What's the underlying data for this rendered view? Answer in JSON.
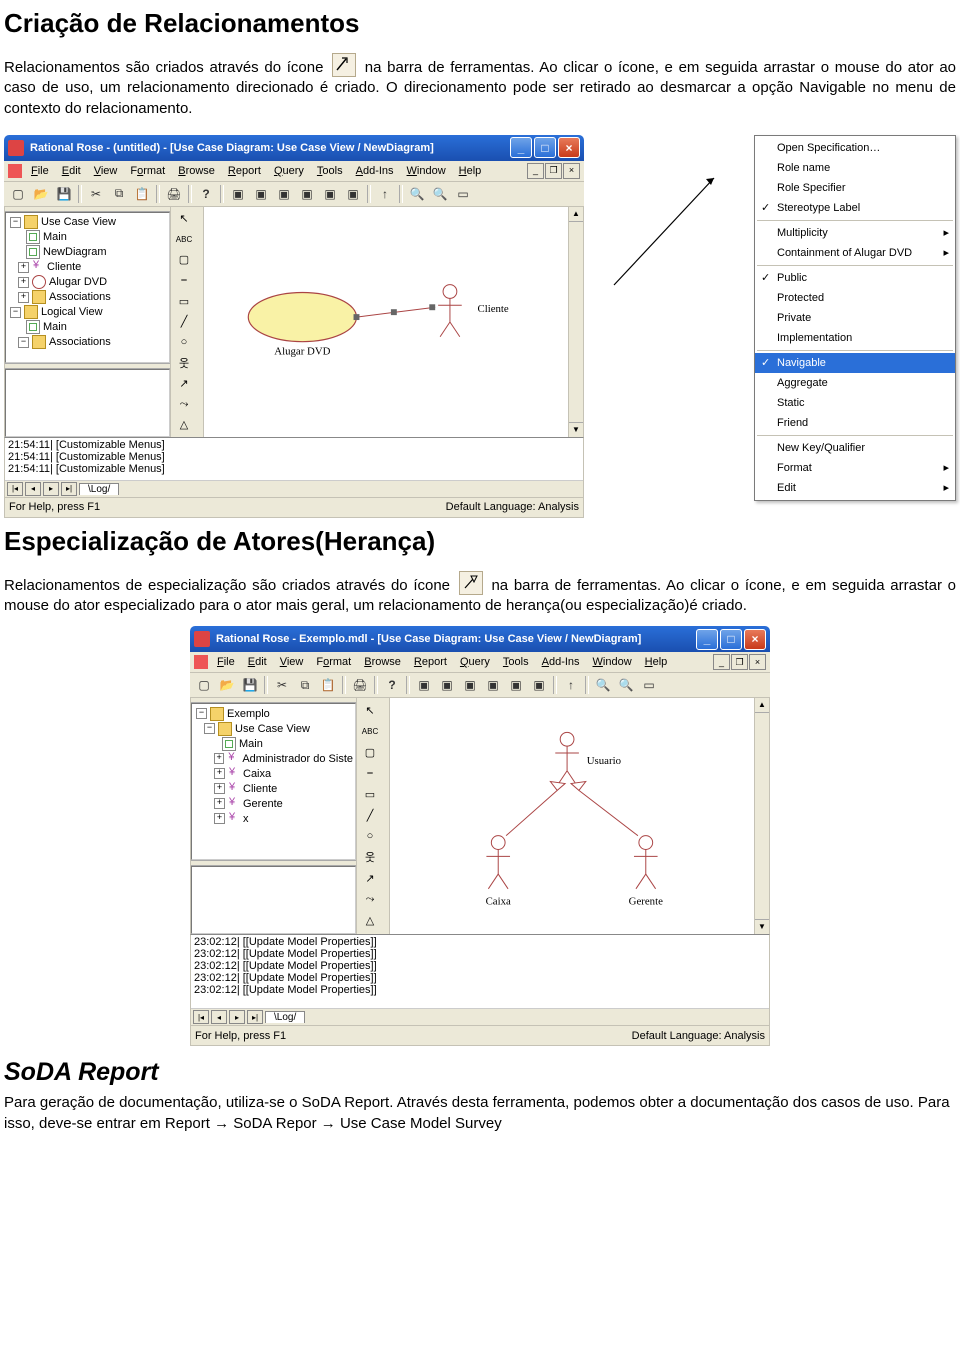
{
  "section1": {
    "title": "Criação de Relacionamentos",
    "p1a": "Relacionamentos são criados através do ícone ",
    "p1b": " na barra de ferramentas. Ao clicar o ícone, e em seguida arrastar o mouse do ator ao caso de uso, um relacionamento direcionado é criado. O direcionamento pode ser retirado ao desmarcar a opção Navigable no menu de contexto do relacionamento."
  },
  "app1": {
    "title": "Rational Rose - (untitled) - [Use Case Diagram: Use Case View / NewDiagram]",
    "menus": [
      "File",
      "Edit",
      "View",
      "Format",
      "Browse",
      "Report",
      "Query",
      "Tools",
      "Add-Ins",
      "Window",
      "Help"
    ],
    "tree": {
      "root": "Use Case View",
      "items": [
        {
          "icon": "diagram",
          "label": "Main",
          "indent": 1
        },
        {
          "icon": "diagram",
          "label": "NewDiagram",
          "indent": 1
        },
        {
          "icon": "actor",
          "label": "Cliente",
          "indent": 1,
          "exp": "+"
        },
        {
          "icon": "usecase",
          "label": "Alugar DVD",
          "indent": 1,
          "exp": "+"
        },
        {
          "icon": "folder",
          "label": "Associations",
          "indent": 1,
          "exp": "+"
        }
      ],
      "root2": "Logical View",
      "items2": [
        {
          "icon": "diagram",
          "label": "Main",
          "indent": 1
        },
        {
          "icon": "folder",
          "label": "Associations",
          "indent": 1,
          "exp": "-"
        }
      ]
    },
    "usecase_label": "Alugar DVD",
    "actor_label": "Cliente",
    "log": [
      "21:54:11|  [Customizable Menus]",
      "21:54:11|  [Customizable Menus]",
      "21:54:11|  [Customizable Menus]"
    ],
    "log_tab": "Log",
    "status_left": "For Help, press F1",
    "status_right": "Default Language: Analysis"
  },
  "ctxmenu": {
    "items": [
      {
        "label": "Open Specification…"
      },
      {
        "label": "Role name"
      },
      {
        "label": "Role Specifier"
      },
      {
        "label": "Stereotype Label",
        "checked": true
      },
      {
        "sep": true
      },
      {
        "label": "Multiplicity",
        "submenu": true
      },
      {
        "label": "Containment of Alugar DVD",
        "submenu": true
      },
      {
        "sep": true
      },
      {
        "label": "Public",
        "checked": true
      },
      {
        "label": "Protected"
      },
      {
        "label": "Private"
      },
      {
        "label": "Implementation"
      },
      {
        "sep": true
      },
      {
        "label": "Navigable",
        "checked": true,
        "sel": true
      },
      {
        "label": "Aggregate"
      },
      {
        "label": "Static"
      },
      {
        "label": "Friend"
      },
      {
        "sep": true
      },
      {
        "label": "New Key/Qualifier"
      },
      {
        "label": "Format",
        "submenu": true
      },
      {
        "label": "Edit",
        "submenu": true
      }
    ]
  },
  "section2": {
    "title": "Especialização de Atores(Herança)",
    "p1a": "Relacionamentos de especialização são criados através do ícone ",
    "p1b": " na barra de ferramentas. Ao clicar o ícone, e em seguida arrastar o mouse do ator especializado para o ator mais geral, um relacionamento de herança(ou especialização)é criado."
  },
  "app2": {
    "title": "Rational Rose - Exemplo.mdl - [Use Case Diagram: Use Case View / NewDiagram]",
    "tree": {
      "root": "Exemplo",
      "items": [
        {
          "icon": "folder",
          "label": "Use Case View",
          "indent": 1,
          "exp": "-"
        },
        {
          "icon": "diagram",
          "label": "Main",
          "indent": 2
        },
        {
          "icon": "actor",
          "label": "Administrador do Siste",
          "indent": 2,
          "exp": "+"
        },
        {
          "icon": "actor",
          "label": "Caixa",
          "indent": 2,
          "exp": "+"
        },
        {
          "icon": "actor",
          "label": "Cliente",
          "indent": 2,
          "exp": "+"
        },
        {
          "icon": "actor",
          "label": "Gerente",
          "indent": 2,
          "exp": "+"
        },
        {
          "icon": "actor",
          "label": "x",
          "indent": 2,
          "exp": "+"
        }
      ]
    },
    "actor_parent": "Usuario",
    "actor_child1": "Caixa",
    "actor_child2": "Gerente",
    "log": [
      "23:02:12|   [[Update Model Properties]]",
      "23:02:12|   [[Update Model Properties]]",
      "23:02:12|   [[Update Model Properties]]",
      "23:02:12|   [[Update Model Properties]]",
      "23:02:12|   [[Update Model Properties]]"
    ],
    "log_tab": "Log",
    "status_left": "For Help, press F1",
    "status_right": "Default Language: Analysis"
  },
  "section3": {
    "title": "SoDA Report",
    "p": "Para geração de documentação, utiliza-se o SoDA Report. Através desta ferramenta, podemos obter a documentação dos casos de uso. Para isso, deve-se entrar em Report → SoDA Repor → Use Case Model Survey"
  },
  "palette_labels": [
    "pointer",
    "ABC",
    "note",
    "anchor",
    "package",
    "line",
    "usecase",
    "actor",
    "assoc-uni",
    "dependency",
    "generalization"
  ]
}
